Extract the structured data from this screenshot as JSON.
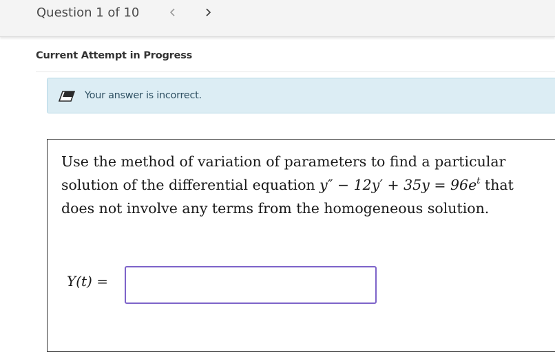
{
  "header": {
    "question_counter": "Question 1 of 10",
    "prev_icon": "chevron-left-icon",
    "next_icon": "chevron-right-icon"
  },
  "attempt": {
    "heading": "Current Attempt in Progress"
  },
  "feedback": {
    "icon": "eraser-icon",
    "message": "Your answer is incorrect."
  },
  "question": {
    "line1": "Use the method of variation of parameters to find a particular",
    "line2_prefix": "solution of the differential equation ",
    "equation_lhs": "y″ − 12y′ + 35y = 96e",
    "equation_exponent": "t",
    "line2_suffix": " that",
    "line3": "does not involve any terms from the homogeneous solution."
  },
  "answer": {
    "label": "Y(t) =",
    "value": "",
    "placeholder": ""
  },
  "colors": {
    "topbar_bg": "#f4f4f4",
    "feedback_bg": "#dcedf4",
    "feedback_border": "#b6d8e6",
    "input_border": "#7d63c9"
  }
}
